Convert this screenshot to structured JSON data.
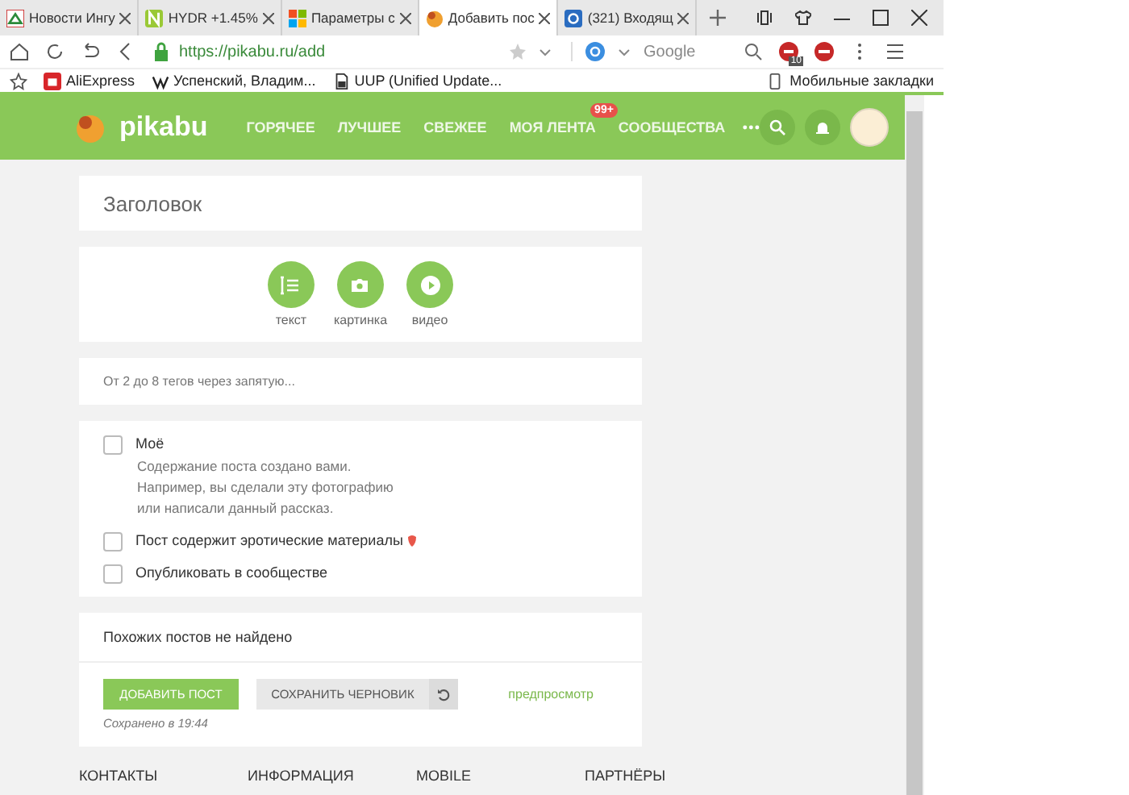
{
  "browser": {
    "tabs": [
      {
        "title": "Новости Ингу",
        "kind": "news",
        "selected": false
      },
      {
        "title": "HYDR +1.45%",
        "kind": "letter",
        "selected": false
      },
      {
        "title": "Параметры с",
        "kind": "tiles",
        "selected": false
      },
      {
        "title": "Добавить пос",
        "kind": "pikabu",
        "selected": true
      },
      {
        "title": "(321) Входящ",
        "kind": "mail",
        "selected": false
      }
    ],
    "address": "https://pikabu.ru/add",
    "search_engine": "Google",
    "extension_badge": "10",
    "bookmarks": [
      {
        "title": "AliExpress",
        "kind": "shop"
      },
      {
        "title": "Успенский, Владим...",
        "kind": "wiki"
      },
      {
        "title": "UUP (Unified Update...",
        "kind": "file"
      }
    ],
    "mobile_bookmarks": "Мобильные закладки"
  },
  "header": {
    "logo": "pikabu",
    "nav": [
      {
        "label": "ГОРЯЧЕЕ"
      },
      {
        "label": "ЛУЧШЕЕ"
      },
      {
        "label": "СВЕЖЕЕ"
      },
      {
        "label": "МОЯ ЛЕНТА",
        "badge": "99+"
      },
      {
        "label": "СООБЩЕСТВА"
      }
    ]
  },
  "form": {
    "title_placeholder": "Заголовок",
    "post_types": [
      {
        "label": "текст",
        "kind": "text"
      },
      {
        "label": "картинка",
        "kind": "image"
      },
      {
        "label": "видео",
        "kind": "video"
      }
    ],
    "tags_placeholder": "От 2 до 8 тегов через запятую...",
    "options": [
      {
        "label": "Моё",
        "checked": false,
        "flagged": false,
        "description": [
          "Содержание поста создано вами.",
          "Например, вы сделали эту фотографию",
          "или написали данный рассказ."
        ]
      },
      {
        "label": "Пост содержит эротические материалы",
        "checked": false,
        "flagged": true
      },
      {
        "label": "Опубликовать в сообществе",
        "checked": false,
        "flagged": false
      }
    ],
    "similar": "Похожих постов не найдено",
    "add_button": "ДОБАВИТЬ ПОСТ",
    "draft_button": "СОХРАНИТЬ ЧЕРНОВИК",
    "saved_note": "Сохранено в 19:44",
    "preview_link": "предпросмотр"
  },
  "footer": {
    "columns": [
      "КОНТАКТЫ",
      "ИНФОРМАЦИЯ",
      "MOBILE",
      "ПАРТНЁРЫ"
    ]
  }
}
